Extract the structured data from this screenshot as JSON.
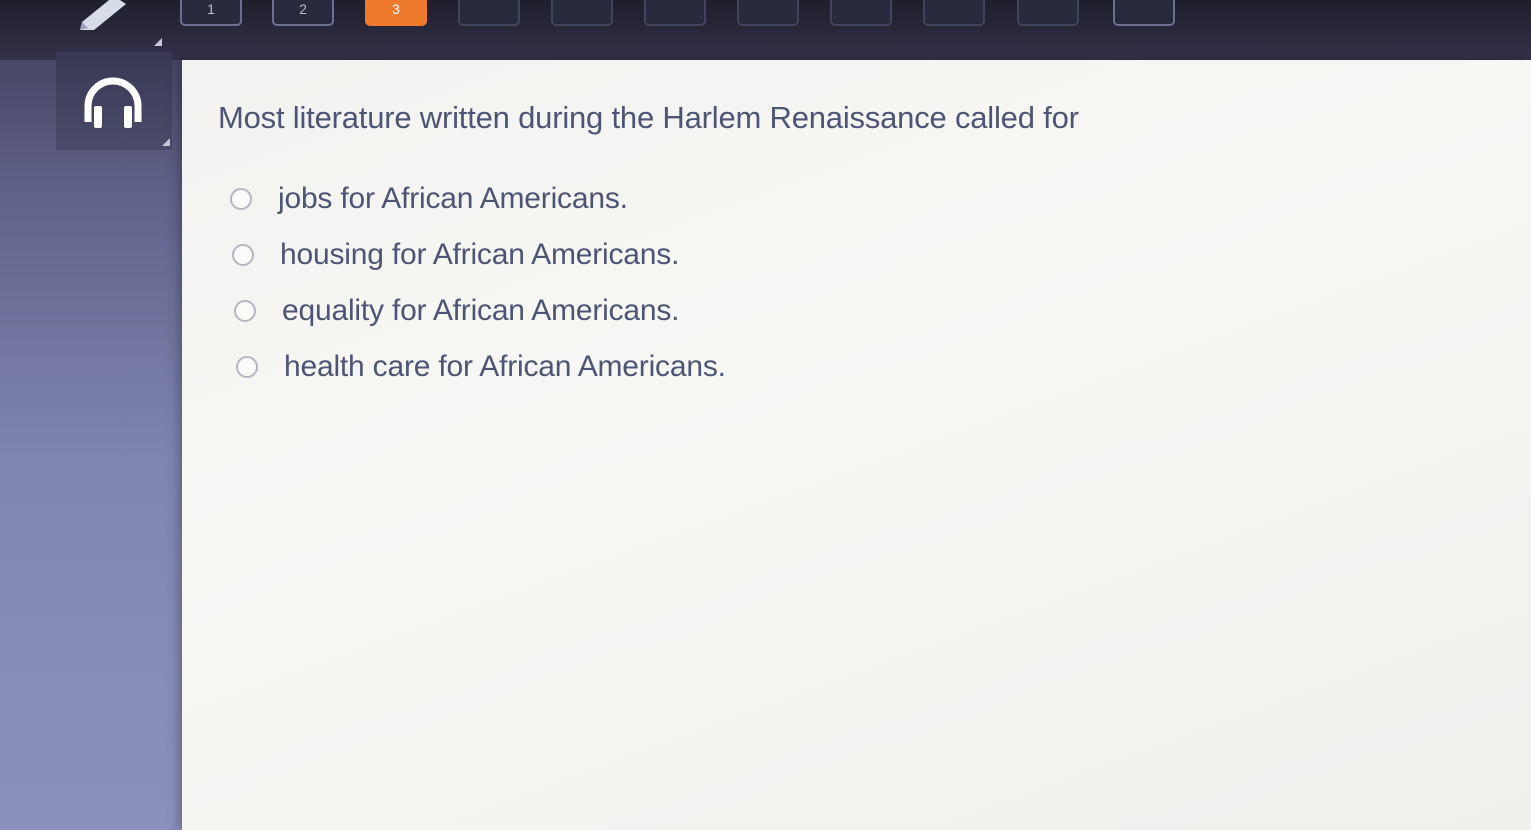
{
  "nav": {
    "tabs": [
      {
        "label": "1",
        "state": "answered"
      },
      {
        "label": "2",
        "state": "answered"
      },
      {
        "label": "3",
        "state": "current"
      },
      {
        "label": "",
        "state": "unvisited"
      },
      {
        "label": "",
        "state": "unvisited"
      },
      {
        "label": "",
        "state": "unvisited"
      },
      {
        "label": "",
        "state": "unvisited"
      },
      {
        "label": "",
        "state": "unvisited"
      },
      {
        "label": "",
        "state": "unvisited"
      },
      {
        "label": "",
        "state": "unvisited"
      },
      {
        "label": "",
        "state": "unvisited"
      }
    ]
  },
  "tools": {
    "pencil_icon": "pencil-icon",
    "audio_icon": "headphones-icon"
  },
  "question": {
    "prompt": "Most literature written during the Harlem Renaissance called for",
    "options": [
      {
        "label": "jobs for African Americans.",
        "selected": false
      },
      {
        "label": "housing for African Americans.",
        "selected": false
      },
      {
        "label": "equality for African Americans.",
        "selected": false
      },
      {
        "label": "health care for African Americans.",
        "selected": false
      }
    ]
  },
  "colors": {
    "accent": "#f07a2c",
    "text": "#4e5475",
    "card": "#f4f4f2"
  }
}
